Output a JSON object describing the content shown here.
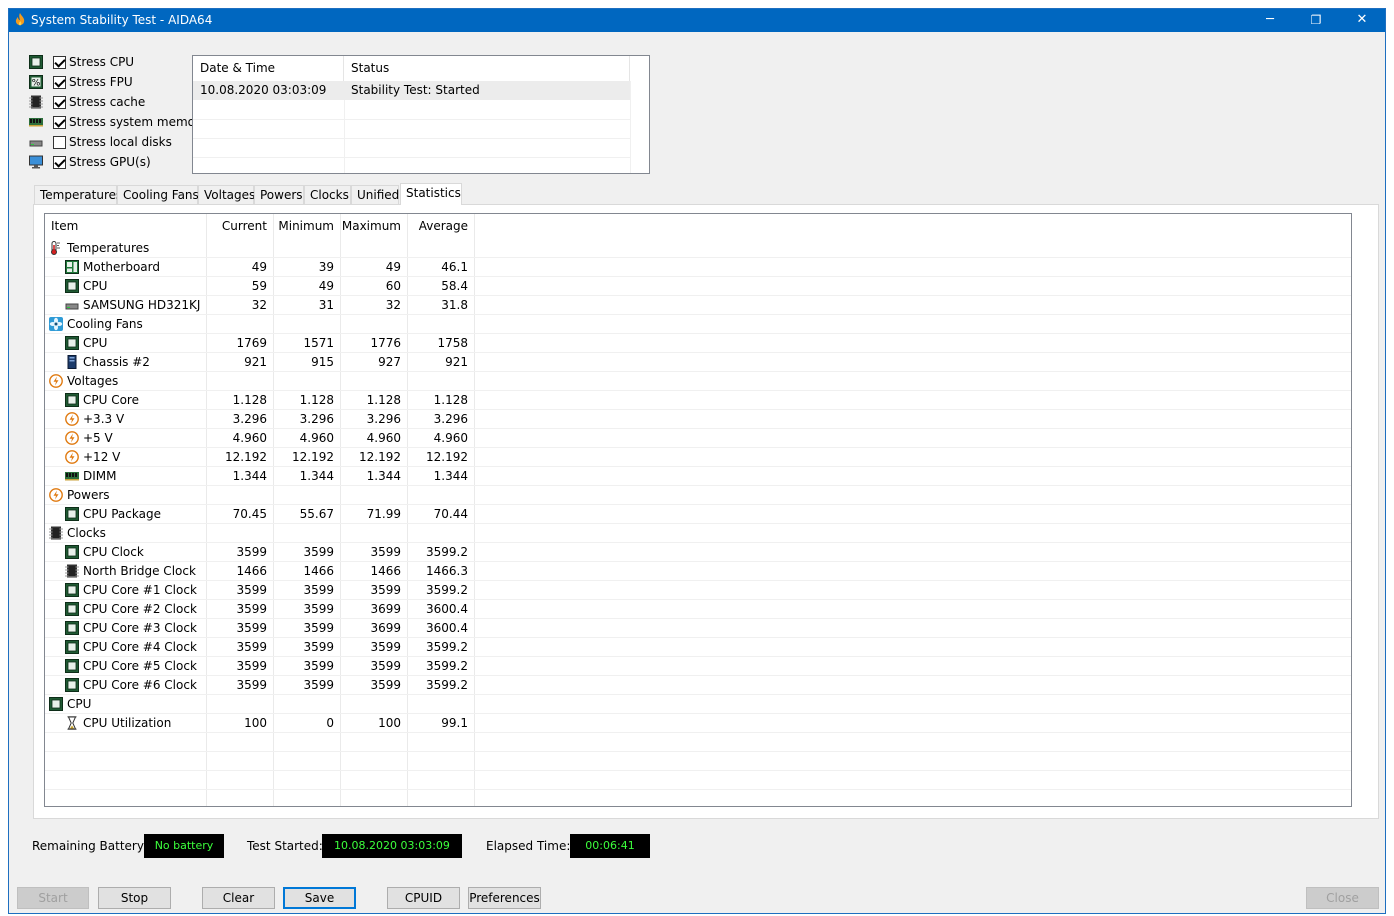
{
  "window": {
    "title": "System Stability Test - AIDA64",
    "minimize": "─",
    "restore": "❐",
    "close": "✕"
  },
  "stress": [
    {
      "label": "Stress CPU",
      "checked": true,
      "icon": "cpu-chip-icon"
    },
    {
      "label": "Stress FPU",
      "checked": true,
      "icon": "fpu-percent-icon"
    },
    {
      "label": "Stress cache",
      "checked": true,
      "icon": "cache-chip-icon"
    },
    {
      "label": "Stress system memory",
      "checked": true,
      "icon": "memory-module-icon"
    },
    {
      "label": "Stress local disks",
      "checked": false,
      "icon": "disk-drive-icon"
    },
    {
      "label": "Stress GPU(s)",
      "checked": true,
      "icon": "monitor-icon"
    }
  ],
  "log": {
    "headers": [
      "Date & Time",
      "Status"
    ],
    "rows": [
      {
        "datetime": "10.08.2020 03:03:09",
        "status": "Stability Test: Started"
      }
    ]
  },
  "tabs": [
    "Temperatures",
    "Cooling Fans",
    "Voltages",
    "Powers",
    "Clocks",
    "Unified",
    "Statistics"
  ],
  "active_tab": "Statistics",
  "stats": {
    "headers": [
      "Item",
      "Current",
      "Minimum",
      "Maximum",
      "Average"
    ],
    "rows": [
      {
        "type": "group",
        "name": "Temperatures",
        "icon": "thermometer-icon"
      },
      {
        "type": "item",
        "name": "Motherboard",
        "icon": "motherboard-icon",
        "current": "49",
        "minimum": "39",
        "maximum": "49",
        "average": "46.1"
      },
      {
        "type": "item",
        "name": "CPU",
        "icon": "cpu-chip-icon",
        "current": "59",
        "minimum": "49",
        "maximum": "60",
        "average": "58.4"
      },
      {
        "type": "item",
        "name": "SAMSUNG HD321KJ",
        "icon": "disk-drive-icon",
        "current": "32",
        "minimum": "31",
        "maximum": "32",
        "average": "31.8"
      },
      {
        "type": "group",
        "name": "Cooling Fans",
        "icon": "fan-icon"
      },
      {
        "type": "item",
        "name": "CPU",
        "icon": "cpu-chip-icon",
        "current": "1769",
        "minimum": "1571",
        "maximum": "1776",
        "average": "1758"
      },
      {
        "type": "item",
        "name": "Chassis #2",
        "icon": "chassis-icon",
        "current": "921",
        "minimum": "915",
        "maximum": "927",
        "average": "921"
      },
      {
        "type": "group",
        "name": "Voltages",
        "icon": "voltage-icon"
      },
      {
        "type": "item",
        "name": "CPU Core",
        "icon": "cpu-chip-icon",
        "current": "1.128",
        "minimum": "1.128",
        "maximum": "1.128",
        "average": "1.128"
      },
      {
        "type": "item",
        "name": "+3.3 V",
        "icon": "voltage-icon",
        "current": "3.296",
        "minimum": "3.296",
        "maximum": "3.296",
        "average": "3.296"
      },
      {
        "type": "item",
        "name": "+5 V",
        "icon": "voltage-icon",
        "current": "4.960",
        "minimum": "4.960",
        "maximum": "4.960",
        "average": "4.960"
      },
      {
        "type": "item",
        "name": "+12 V",
        "icon": "voltage-icon",
        "current": "12.192",
        "minimum": "12.192",
        "maximum": "12.192",
        "average": "12.192"
      },
      {
        "type": "item",
        "name": "DIMM",
        "icon": "memory-module-icon",
        "current": "1.344",
        "minimum": "1.344",
        "maximum": "1.344",
        "average": "1.344"
      },
      {
        "type": "group",
        "name": "Powers",
        "icon": "voltage-icon"
      },
      {
        "type": "item",
        "name": "CPU Package",
        "icon": "cpu-chip-icon",
        "current": "70.45",
        "minimum": "55.67",
        "maximum": "71.99",
        "average": "70.44"
      },
      {
        "type": "group",
        "name": "Clocks",
        "icon": "clock-chip-icon"
      },
      {
        "type": "item",
        "name": "CPU Clock",
        "icon": "cpu-chip-icon",
        "current": "3599",
        "minimum": "3599",
        "maximum": "3599",
        "average": "3599.2"
      },
      {
        "type": "item",
        "name": "North Bridge Clock",
        "icon": "clock-chip-icon",
        "current": "1466",
        "minimum": "1466",
        "maximum": "1466",
        "average": "1466.3"
      },
      {
        "type": "item",
        "name": "CPU Core #1 Clock",
        "icon": "cpu-chip-icon",
        "current": "3599",
        "minimum": "3599",
        "maximum": "3599",
        "average": "3599.2"
      },
      {
        "type": "item",
        "name": "CPU Core #2 Clock",
        "icon": "cpu-chip-icon",
        "current": "3599",
        "minimum": "3599",
        "maximum": "3699",
        "average": "3600.4"
      },
      {
        "type": "item",
        "name": "CPU Core #3 Clock",
        "icon": "cpu-chip-icon",
        "current": "3599",
        "minimum": "3599",
        "maximum": "3699",
        "average": "3600.4"
      },
      {
        "type": "item",
        "name": "CPU Core #4 Clock",
        "icon": "cpu-chip-icon",
        "current": "3599",
        "minimum": "3599",
        "maximum": "3599",
        "average": "3599.2"
      },
      {
        "type": "item",
        "name": "CPU Core #5 Clock",
        "icon": "cpu-chip-icon",
        "current": "3599",
        "minimum": "3599",
        "maximum": "3599",
        "average": "3599.2"
      },
      {
        "type": "item",
        "name": "CPU Core #6 Clock",
        "icon": "cpu-chip-icon",
        "current": "3599",
        "minimum": "3599",
        "maximum": "3599",
        "average": "3599.2"
      },
      {
        "type": "group",
        "name": "CPU",
        "icon": "cpu-chip-icon"
      },
      {
        "type": "item",
        "name": "CPU Utilization",
        "icon": "hourglass-icon",
        "current": "100",
        "minimum": "0",
        "maximum": "100",
        "average": "99.1"
      }
    ]
  },
  "status": {
    "battery_label": "Remaining Battery:",
    "battery_value": "No battery",
    "started_label": "Test Started:",
    "started_value": "10.08.2020 03:03:09",
    "elapsed_label": "Elapsed Time:",
    "elapsed_value": "00:06:41"
  },
  "buttons": {
    "start": "Start",
    "stop": "Stop",
    "clear": "Clear",
    "save": "Save",
    "cpuid": "CPUID",
    "preferences": "Preferences",
    "close": "Close"
  },
  "colors": {
    "titlebar": "#0067c0",
    "lcd_bg": "#000000",
    "lcd_text": "#3cff3c",
    "accent_blue": "#0078d7"
  }
}
